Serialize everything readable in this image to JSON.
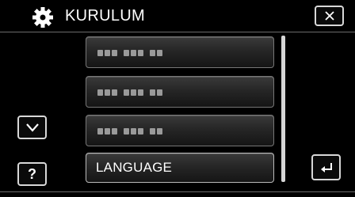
{
  "header": {
    "title": "KURULUM",
    "icon": "gear-icon"
  },
  "buttons": {
    "close_icon": "close-icon",
    "down_icon": "chevron-down-icon",
    "help_label": "?",
    "back_icon": "return-arrow-icon"
  },
  "menu": {
    "items": [
      {
        "label": "",
        "icon": "redacted-label"
      },
      {
        "label": "",
        "icon": "redacted-label"
      },
      {
        "label": "",
        "icon": "redacted-label"
      },
      {
        "label": "LANGUAGE"
      }
    ]
  }
}
